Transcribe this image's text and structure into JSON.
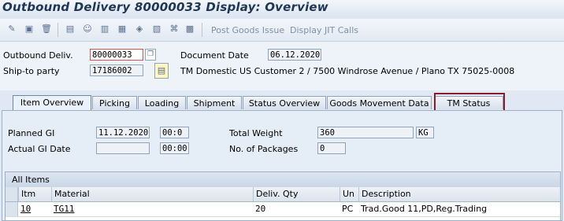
{
  "window": {
    "title": "Outbound Delivery 80000033 Display: Overview"
  },
  "toolbar": {
    "icons": [
      "edit-icon",
      "create-icon",
      "delete-icon",
      "goods-icon",
      "partner-icon",
      "header-icon",
      "item-icon",
      "shipment-icon",
      "pack-icon",
      "flow-icon",
      "overview-icon"
    ],
    "post_goods_issue": "Post Goods Issue",
    "display_jit_calls": "Display JIT Calls"
  },
  "header": {
    "outbound_deliv_label": "Outbound Deliv.",
    "outbound_deliv_value": "80000033",
    "document_date_label": "Document Date",
    "document_date_value": "06.12.2020",
    "ship_to_label": "Ship-to party",
    "ship_to_value": "17186002",
    "ship_to_desc": "TM Domestic US Customer 2 / 7500 Windrose Avenue / Plano TX 75025-0008"
  },
  "tabs": [
    {
      "label": "Item Overview",
      "active": true
    },
    {
      "label": "Picking"
    },
    {
      "label": "Loading"
    },
    {
      "label": "Shipment"
    },
    {
      "label": "Status Overview"
    },
    {
      "label": "Goods Movement Data"
    },
    {
      "label": "TM Status"
    }
  ],
  "overview": {
    "planned_gi_label": "Planned GI",
    "planned_gi_date": "11.12.2020",
    "planned_gi_time": "00:0",
    "actual_gi_label": "Actual GI Date",
    "actual_gi_date": "",
    "actual_gi_time": "00:00",
    "total_weight_label": "Total Weight",
    "total_weight_value": "360",
    "total_weight_unit": "KG",
    "packages_label": "No. of Packages",
    "packages_value": "0"
  },
  "items_table": {
    "title": "All Items",
    "columns": [
      "Itm",
      "Material",
      "Deliv. Qty",
      "Un",
      "Description"
    ],
    "rows": [
      {
        "itm": "10",
        "material": "TG11",
        "qty": "20",
        "un": "PC",
        "description": "Trad.Good 11,PD,Reg.Trading"
      }
    ]
  }
}
